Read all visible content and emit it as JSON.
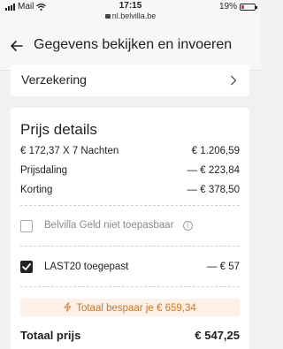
{
  "status_bar": {
    "carrier": "Mail",
    "time": "17:15",
    "url": "nl.belvilla.be",
    "battery": "19%",
    "battery_level": 0.19
  },
  "header": {
    "title": "Gegevens bekijken en invoeren"
  },
  "insurance": {
    "label": "Verzekering"
  },
  "price_details": {
    "title": "Prijs details",
    "rows": [
      {
        "label": "€ 172,37 X 7 Nachten",
        "value": "€ 1.206,59"
      },
      {
        "label": "Prijsdaling",
        "value": "— € 223,84"
      },
      {
        "label": "Korting",
        "value": "— € 378,50"
      }
    ],
    "belvilla_money": {
      "label": "Belvilla Geld niet toepasbaar",
      "checked": false
    },
    "coupon": {
      "label": "LAST20 toegepast",
      "value": "— € 57",
      "checked": true
    },
    "savings": "Totaal bespaar je € 659,34",
    "total": {
      "label": "Totaal prijs",
      "value": "€ 547,25"
    }
  },
  "colors": {
    "savings_bg": "#fdf0e6",
    "savings_text": "#c77a2b",
    "battery_low": "#ee3333"
  }
}
